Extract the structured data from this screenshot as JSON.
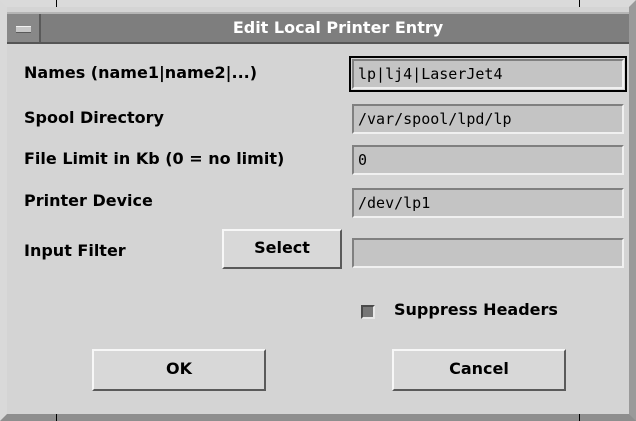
{
  "window": {
    "title": "Edit Local Printer Entry"
  },
  "fields": {
    "names": {
      "label": "Names (name1|name2|...)",
      "value": "lp|lj4|LaserJet4"
    },
    "spool": {
      "label": "Spool Directory",
      "value": "/var/spool/lpd/lp"
    },
    "limit": {
      "label": "File Limit in Kb (0 = no limit)",
      "value": "0"
    },
    "device": {
      "label": "Printer Device",
      "value": "/dev/lp1"
    },
    "filter": {
      "label": "Input Filter",
      "value": "",
      "select_label": "Select"
    }
  },
  "options": {
    "suppress_headers": {
      "label": "Suppress Headers",
      "checked": true
    }
  },
  "buttons": {
    "ok_label": "OK",
    "cancel_label": "Cancel"
  }
}
